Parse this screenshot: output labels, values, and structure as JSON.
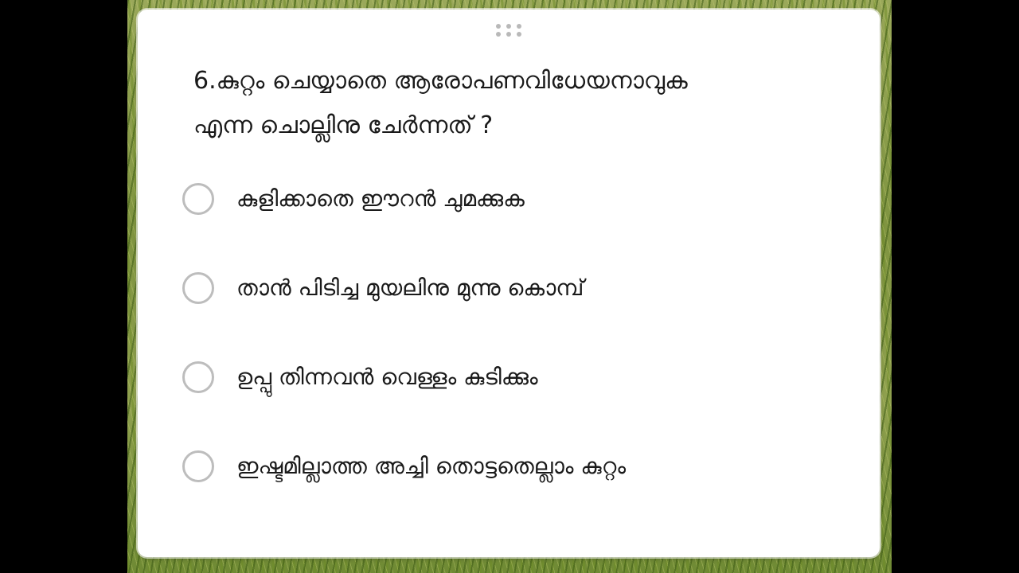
{
  "quiz": {
    "question_line1": "6.കുറ്റം ചെയ്യാതെ ആരോപണവിധേയനാവുക",
    "question_line2": "എന്ന ചൊല്ലിനു ചേർന്നത് ?",
    "options": [
      {
        "label": "കുളിക്കാതെ ഈറൻ ചുമക്കുക",
        "selected": false
      },
      {
        "label": "താൻ പിടിച്ച മുയലിനു മുന്നു കൊമ്പ്",
        "selected": false
      },
      {
        "label": "ഉപ്പു തിന്നവൻ വെള്ളം കുടിക്കും",
        "selected": false
      },
      {
        "label": "ഇഷ്ടമില്ലാത്ത  അച്ചി തൊട്ടതെല്ലാം കുറ്റം",
        "selected": false
      }
    ]
  },
  "colors": {
    "card_background": "#ffffff",
    "text": "#1a1a1a",
    "radio_border": "#bdbdbd",
    "drag_handle": "#b9b9b9",
    "letterbox": "#000000"
  },
  "icons": {
    "drag_handle": "drag-handle-icon",
    "radio": "radio-unchecked-icon"
  }
}
